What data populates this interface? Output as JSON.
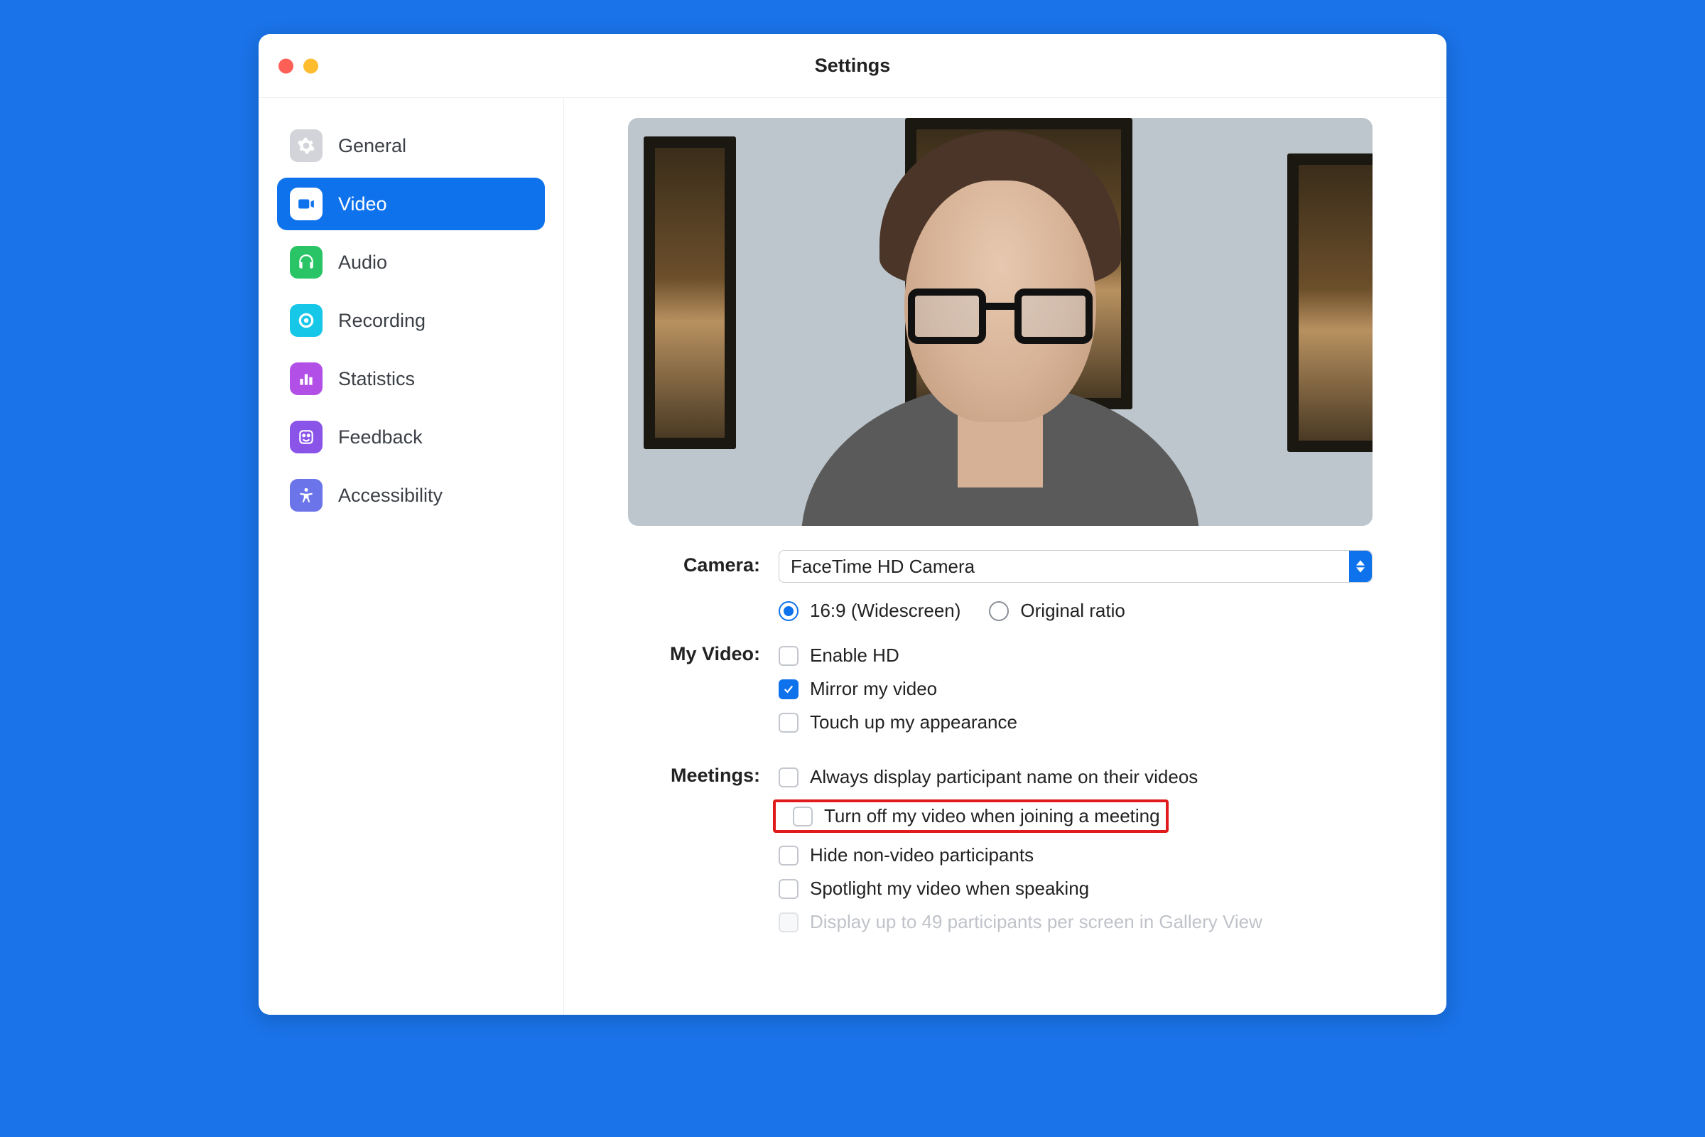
{
  "window": {
    "title": "Settings"
  },
  "sidebar": {
    "items": [
      {
        "label": "General"
      },
      {
        "label": "Video"
      },
      {
        "label": "Audio"
      },
      {
        "label": "Recording"
      },
      {
        "label": "Statistics"
      },
      {
        "label": "Feedback"
      },
      {
        "label": "Accessibility"
      }
    ],
    "active_index": 1
  },
  "camera": {
    "label": "Camera:",
    "selected": "FaceTime HD Camera",
    "ratio_options": {
      "widescreen": "16:9 (Widescreen)",
      "original": "Original ratio"
    },
    "ratio_selected": "widescreen"
  },
  "myvideo": {
    "label": "My Video:",
    "options": [
      {
        "label": "Enable HD",
        "checked": false
      },
      {
        "label": "Mirror my video",
        "checked": true
      },
      {
        "label": "Touch up my appearance",
        "checked": false
      }
    ]
  },
  "meetings": {
    "label": "Meetings:",
    "options": [
      {
        "label": "Always display participant name on their videos",
        "checked": false,
        "highlighted": false
      },
      {
        "label": "Turn off my video when joining a meeting",
        "checked": false,
        "highlighted": true
      },
      {
        "label": "Hide non-video participants",
        "checked": false,
        "highlighted": false
      },
      {
        "label": "Spotlight my video when speaking",
        "checked": false,
        "highlighted": false
      },
      {
        "label": "Display up to 49 participants per screen in Gallery View",
        "checked": false,
        "highlighted": false,
        "disabled": true
      }
    ]
  }
}
